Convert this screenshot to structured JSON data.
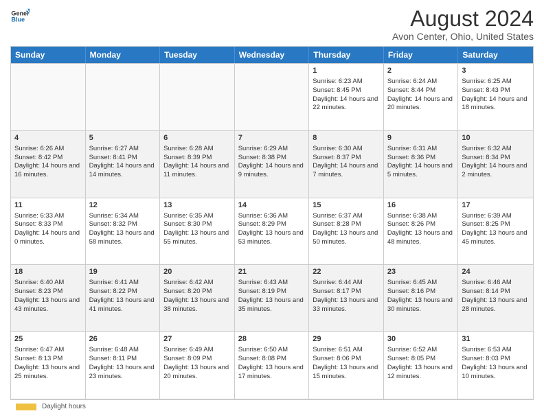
{
  "logo": {
    "line1": "General",
    "line2": "Blue"
  },
  "title": "August 2024",
  "subtitle": "Avon Center, Ohio, United States",
  "days_of_week": [
    "Sunday",
    "Monday",
    "Tuesday",
    "Wednesday",
    "Thursday",
    "Friday",
    "Saturday"
  ],
  "legend_label": "Daylight hours",
  "weeks": [
    [
      {
        "day": "",
        "sunrise": "",
        "sunset": "",
        "daylight": "",
        "empty": true
      },
      {
        "day": "",
        "sunrise": "",
        "sunset": "",
        "daylight": "",
        "empty": true
      },
      {
        "day": "",
        "sunrise": "",
        "sunset": "",
        "daylight": "",
        "empty": true
      },
      {
        "day": "",
        "sunrise": "",
        "sunset": "",
        "daylight": "",
        "empty": true
      },
      {
        "day": "1",
        "sunrise": "Sunrise: 6:23 AM",
        "sunset": "Sunset: 8:45 PM",
        "daylight": "Daylight: 14 hours and 22 minutes.",
        "empty": false
      },
      {
        "day": "2",
        "sunrise": "Sunrise: 6:24 AM",
        "sunset": "Sunset: 8:44 PM",
        "daylight": "Daylight: 14 hours and 20 minutes.",
        "empty": false
      },
      {
        "day": "3",
        "sunrise": "Sunrise: 6:25 AM",
        "sunset": "Sunset: 8:43 PM",
        "daylight": "Daylight: 14 hours and 18 minutes.",
        "empty": false
      }
    ],
    [
      {
        "day": "4",
        "sunrise": "Sunrise: 6:26 AM",
        "sunset": "Sunset: 8:42 PM",
        "daylight": "Daylight: 14 hours and 16 minutes.",
        "empty": false
      },
      {
        "day": "5",
        "sunrise": "Sunrise: 6:27 AM",
        "sunset": "Sunset: 8:41 PM",
        "daylight": "Daylight: 14 hours and 14 minutes.",
        "empty": false
      },
      {
        "day": "6",
        "sunrise": "Sunrise: 6:28 AM",
        "sunset": "Sunset: 8:39 PM",
        "daylight": "Daylight: 14 hours and 11 minutes.",
        "empty": false
      },
      {
        "day": "7",
        "sunrise": "Sunrise: 6:29 AM",
        "sunset": "Sunset: 8:38 PM",
        "daylight": "Daylight: 14 hours and 9 minutes.",
        "empty": false
      },
      {
        "day": "8",
        "sunrise": "Sunrise: 6:30 AM",
        "sunset": "Sunset: 8:37 PM",
        "daylight": "Daylight: 14 hours and 7 minutes.",
        "empty": false
      },
      {
        "day": "9",
        "sunrise": "Sunrise: 6:31 AM",
        "sunset": "Sunset: 8:36 PM",
        "daylight": "Daylight: 14 hours and 5 minutes.",
        "empty": false
      },
      {
        "day": "10",
        "sunrise": "Sunrise: 6:32 AM",
        "sunset": "Sunset: 8:34 PM",
        "daylight": "Daylight: 14 hours and 2 minutes.",
        "empty": false
      }
    ],
    [
      {
        "day": "11",
        "sunrise": "Sunrise: 6:33 AM",
        "sunset": "Sunset: 8:33 PM",
        "daylight": "Daylight: 14 hours and 0 minutes.",
        "empty": false
      },
      {
        "day": "12",
        "sunrise": "Sunrise: 6:34 AM",
        "sunset": "Sunset: 8:32 PM",
        "daylight": "Daylight: 13 hours and 58 minutes.",
        "empty": false
      },
      {
        "day": "13",
        "sunrise": "Sunrise: 6:35 AM",
        "sunset": "Sunset: 8:30 PM",
        "daylight": "Daylight: 13 hours and 55 minutes.",
        "empty": false
      },
      {
        "day": "14",
        "sunrise": "Sunrise: 6:36 AM",
        "sunset": "Sunset: 8:29 PM",
        "daylight": "Daylight: 13 hours and 53 minutes.",
        "empty": false
      },
      {
        "day": "15",
        "sunrise": "Sunrise: 6:37 AM",
        "sunset": "Sunset: 8:28 PM",
        "daylight": "Daylight: 13 hours and 50 minutes.",
        "empty": false
      },
      {
        "day": "16",
        "sunrise": "Sunrise: 6:38 AM",
        "sunset": "Sunset: 8:26 PM",
        "daylight": "Daylight: 13 hours and 48 minutes.",
        "empty": false
      },
      {
        "day": "17",
        "sunrise": "Sunrise: 6:39 AM",
        "sunset": "Sunset: 8:25 PM",
        "daylight": "Daylight: 13 hours and 45 minutes.",
        "empty": false
      }
    ],
    [
      {
        "day": "18",
        "sunrise": "Sunrise: 6:40 AM",
        "sunset": "Sunset: 8:23 PM",
        "daylight": "Daylight: 13 hours and 43 minutes.",
        "empty": false
      },
      {
        "day": "19",
        "sunrise": "Sunrise: 6:41 AM",
        "sunset": "Sunset: 8:22 PM",
        "daylight": "Daylight: 13 hours and 41 minutes.",
        "empty": false
      },
      {
        "day": "20",
        "sunrise": "Sunrise: 6:42 AM",
        "sunset": "Sunset: 8:20 PM",
        "daylight": "Daylight: 13 hours and 38 minutes.",
        "empty": false
      },
      {
        "day": "21",
        "sunrise": "Sunrise: 6:43 AM",
        "sunset": "Sunset: 8:19 PM",
        "daylight": "Daylight: 13 hours and 35 minutes.",
        "empty": false
      },
      {
        "day": "22",
        "sunrise": "Sunrise: 6:44 AM",
        "sunset": "Sunset: 8:17 PM",
        "daylight": "Daylight: 13 hours and 33 minutes.",
        "empty": false
      },
      {
        "day": "23",
        "sunrise": "Sunrise: 6:45 AM",
        "sunset": "Sunset: 8:16 PM",
        "daylight": "Daylight: 13 hours and 30 minutes.",
        "empty": false
      },
      {
        "day": "24",
        "sunrise": "Sunrise: 6:46 AM",
        "sunset": "Sunset: 8:14 PM",
        "daylight": "Daylight: 13 hours and 28 minutes.",
        "empty": false
      }
    ],
    [
      {
        "day": "25",
        "sunrise": "Sunrise: 6:47 AM",
        "sunset": "Sunset: 8:13 PM",
        "daylight": "Daylight: 13 hours and 25 minutes.",
        "empty": false
      },
      {
        "day": "26",
        "sunrise": "Sunrise: 6:48 AM",
        "sunset": "Sunset: 8:11 PM",
        "daylight": "Daylight: 13 hours and 23 minutes.",
        "empty": false
      },
      {
        "day": "27",
        "sunrise": "Sunrise: 6:49 AM",
        "sunset": "Sunset: 8:09 PM",
        "daylight": "Daylight: 13 hours and 20 minutes.",
        "empty": false
      },
      {
        "day": "28",
        "sunrise": "Sunrise: 6:50 AM",
        "sunset": "Sunset: 8:08 PM",
        "daylight": "Daylight: 13 hours and 17 minutes.",
        "empty": false
      },
      {
        "day": "29",
        "sunrise": "Sunrise: 6:51 AM",
        "sunset": "Sunset: 8:06 PM",
        "daylight": "Daylight: 13 hours and 15 minutes.",
        "empty": false
      },
      {
        "day": "30",
        "sunrise": "Sunrise: 6:52 AM",
        "sunset": "Sunset: 8:05 PM",
        "daylight": "Daylight: 13 hours and 12 minutes.",
        "empty": false
      },
      {
        "day": "31",
        "sunrise": "Sunrise: 6:53 AM",
        "sunset": "Sunset: 8:03 PM",
        "daylight": "Daylight: 13 hours and 10 minutes.",
        "empty": false
      }
    ]
  ]
}
